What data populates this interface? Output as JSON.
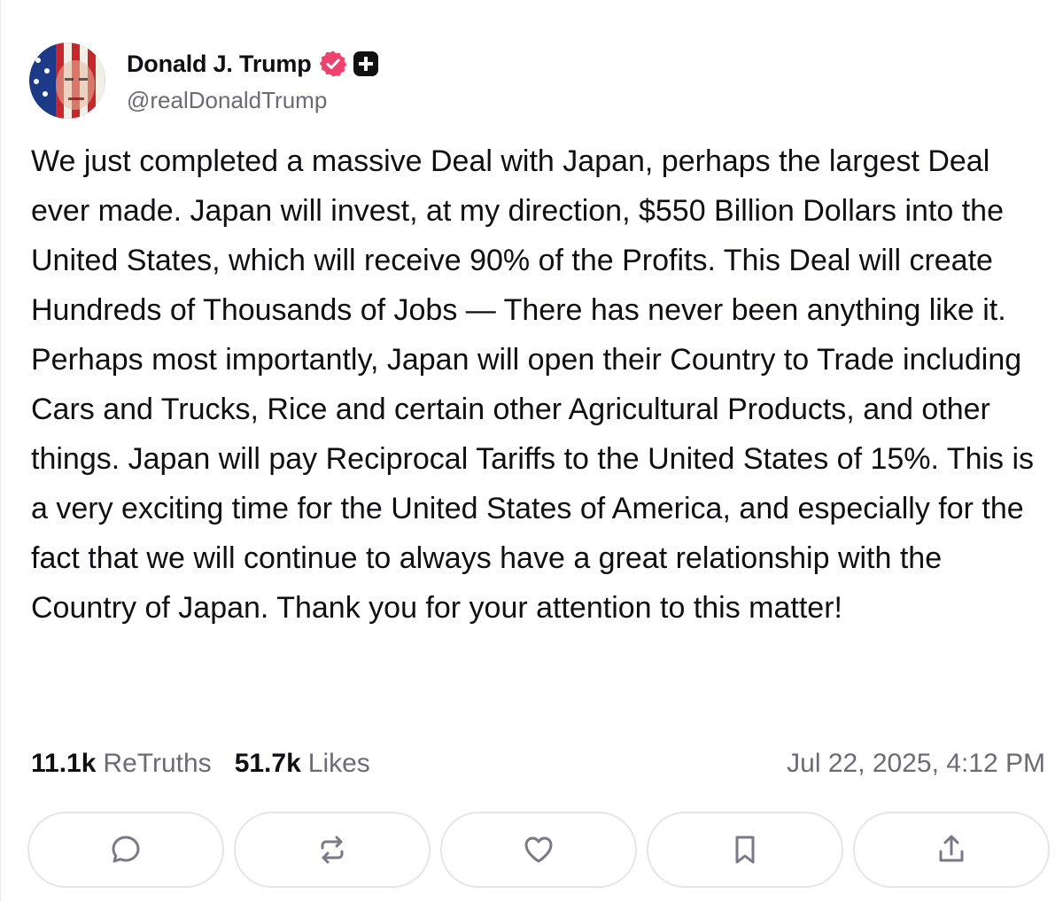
{
  "post": {
    "author": {
      "display_name": "Donald J. Trump",
      "handle": "@realDonaldTrump",
      "verified_icon": "verified-badge-icon",
      "badge_icon": "plus-badge-icon",
      "verified_color": "#f0426e"
    },
    "text": "We just completed a massive Deal with Japan, perhaps the largest Deal ever made. Japan will invest, at my direction, $550 Billion Dollars into the United States, which will receive 90% of the Profits. This Deal will create Hundreds of Thousands of Jobs — There has never been anything like it. Perhaps most importantly, Japan will open their Country to Trade including Cars and Trucks, Rice and certain other Agricultural Products, and other things. Japan will pay Reciprocal Tariffs to the United States of 15%. This is a very exciting time for the United States of America, and especially for the fact that we will continue to always have a great relationship with the Country of Japan. Thank you for your attention to this matter!",
    "stats": {
      "retruths_count": "11.1k",
      "retruths_label": "ReTruths",
      "likes_count": "51.7k",
      "likes_label": "Likes"
    },
    "timestamp": "Jul 22, 2025, 4:12 PM",
    "actions": [
      {
        "icon": "comment-icon"
      },
      {
        "icon": "retruth-icon"
      },
      {
        "icon": "heart-icon"
      },
      {
        "icon": "bookmark-icon"
      },
      {
        "icon": "share-icon"
      }
    ]
  }
}
